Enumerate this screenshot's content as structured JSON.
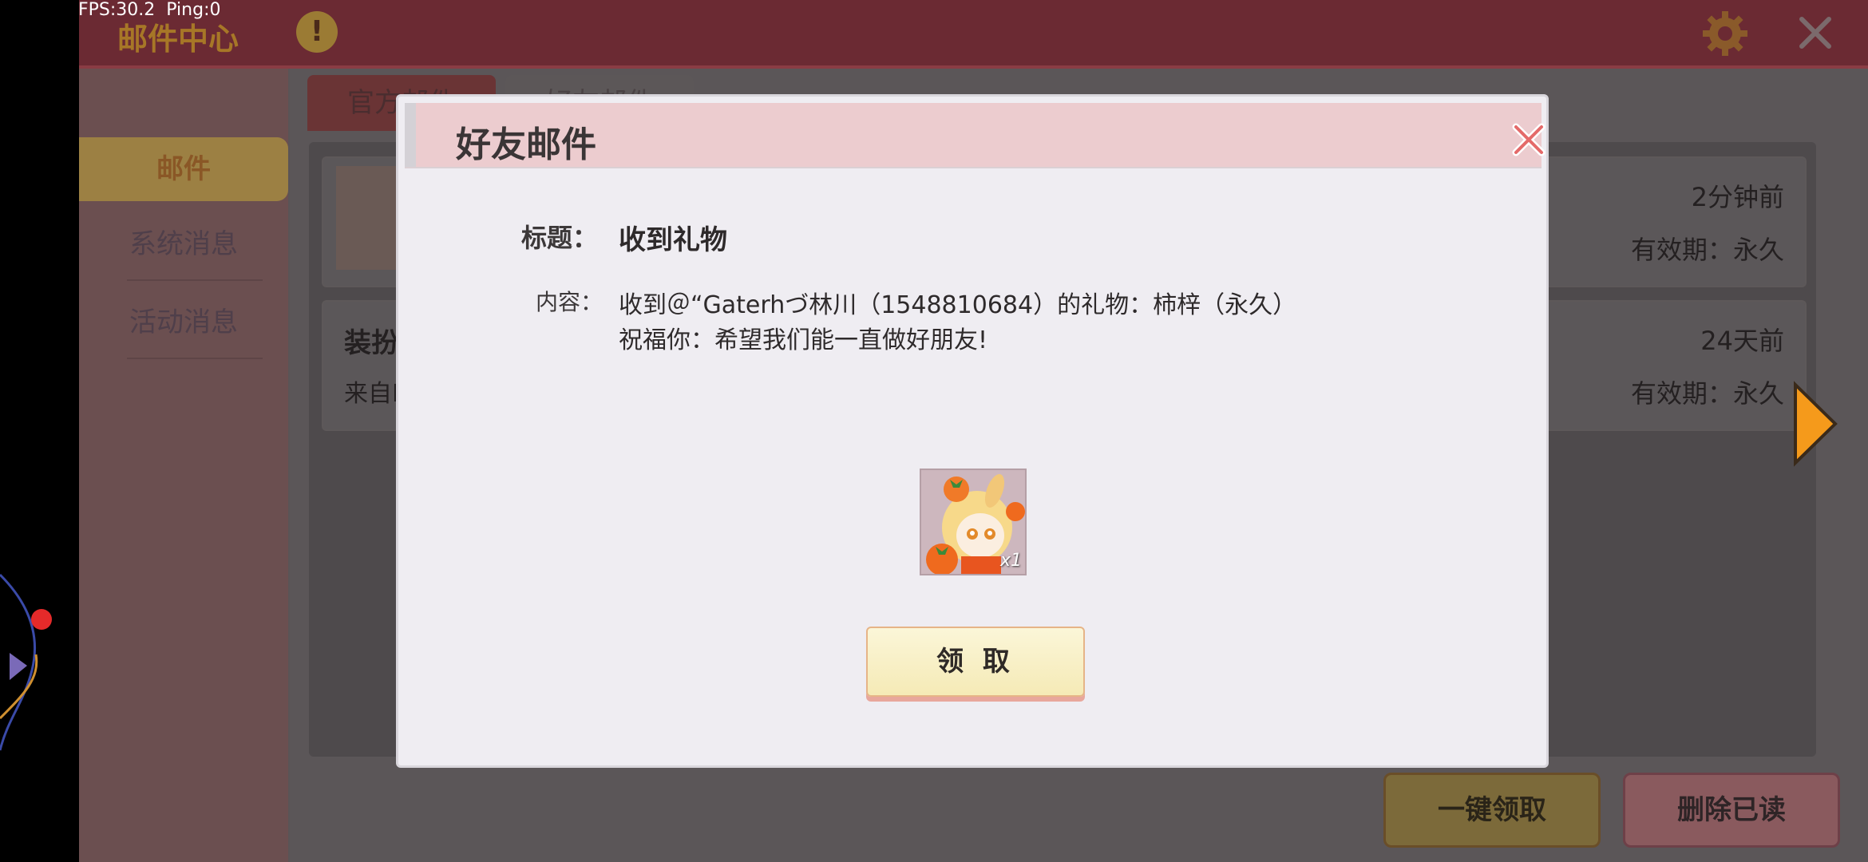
{
  "status": {
    "fps": "FPS:30.2  Ping:0"
  },
  "topbar": {
    "title": "邮件中心",
    "info_glyph": "!"
  },
  "sidebar": {
    "items": [
      {
        "label": "邮件"
      },
      {
        "label": "系统消息"
      },
      {
        "label": "活动消息"
      }
    ]
  },
  "tabs": [
    {
      "label": "官方邮件"
    },
    {
      "label": "好友邮件"
    }
  ],
  "mail_list": [
    {
      "title": "",
      "from": "",
      "time": "2分钟前",
      "expire": "有效期：永久"
    },
    {
      "title": "装扮",
      "from": "来自N",
      "time": "24天前",
      "expire": "有效期：永久"
    }
  ],
  "buttons": {
    "claim_all": "一键领取",
    "delete_read": "删除已读"
  },
  "dialog": {
    "title": "好友邮件",
    "subject_label": "标题：",
    "subject": "收到礼物",
    "content_label": "内容：",
    "content_line1": "收到＠“Gaterhづ林川（1548810684）的礼物：柿梓（永久）",
    "content_line2": "祝福你：希望我们能一直做好朋友!",
    "item_quantity": "x1",
    "claim_button": "领 取"
  },
  "colors": {
    "accent_orange": "#f59a1b",
    "dialog_header": "#eccccf",
    "claim_button": "#f8efc4"
  },
  "icons": [
    "info-icon",
    "gear-icon",
    "close-icon",
    "arrow-right-icon",
    "dialog-close-icon"
  ]
}
